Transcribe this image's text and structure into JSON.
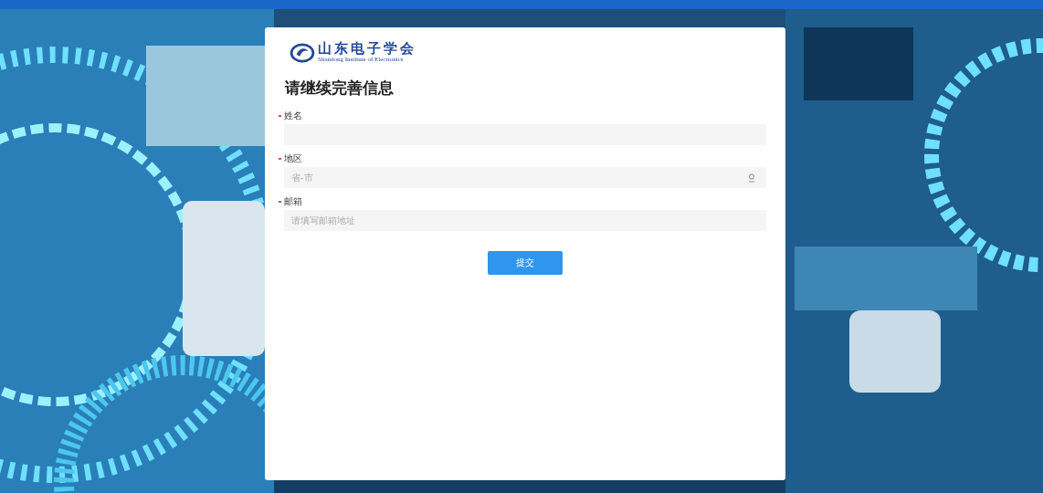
{
  "logo": {
    "name": "山东电子学会",
    "subtitle": "Shandong Institute of Electronics"
  },
  "form": {
    "title": "请继续完善信息",
    "fields": [
      {
        "label": "姓名",
        "required": true,
        "kind": "text"
      },
      {
        "label": "地区",
        "required": true,
        "kind": "region",
        "placeholder": "省-市"
      },
      {
        "label": "邮箱",
        "required": true,
        "kind": "text",
        "placeholder": "请填写邮箱地址"
      }
    ],
    "submit": "提交"
  }
}
